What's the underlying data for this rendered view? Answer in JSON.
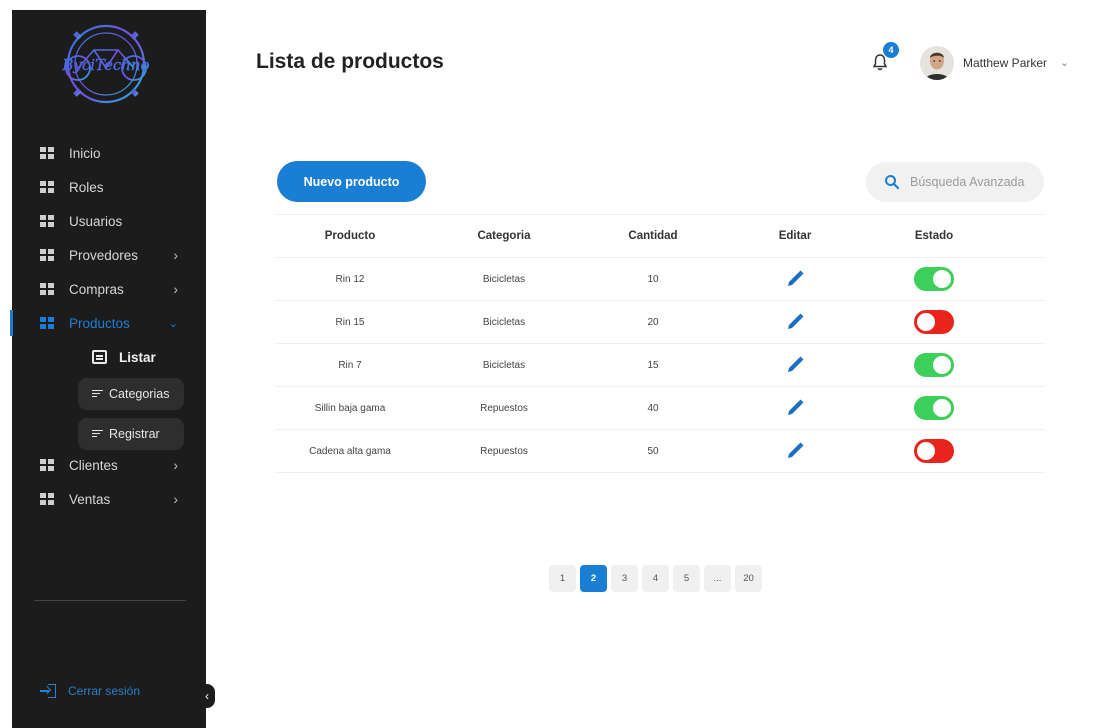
{
  "sidebar": {
    "logo_text": "ByciTechno",
    "items": [
      {
        "label": "Inicio",
        "has_chevron": false,
        "active": false
      },
      {
        "label": "Roles",
        "has_chevron": false,
        "active": false
      },
      {
        "label": "Usuarios",
        "has_chevron": false,
        "active": false
      },
      {
        "label": "Provedores",
        "has_chevron": true,
        "active": false
      },
      {
        "label": "Compras",
        "has_chevron": true,
        "active": false
      },
      {
        "label": "Productos",
        "has_chevron": true,
        "active": true
      }
    ],
    "submenu": {
      "listar": "Listar",
      "categorias": "Categorias",
      "registrar": "Registrar"
    },
    "items_after": [
      {
        "label": "Clientes",
        "has_chevron": true
      },
      {
        "label": "Ventas",
        "has_chevron": true
      }
    ],
    "logout_label": "Cerrar sesión",
    "chevron_right": "›",
    "chevron_down": "⌄"
  },
  "header": {
    "title": "Lista de productos",
    "notification_count": "4",
    "user_name": "Matthew Parker",
    "user_chevron": "⌄"
  },
  "toolbar": {
    "new_button": "Nuevo producto",
    "search_placeholder": "Búsqueda Avanzada"
  },
  "table": {
    "columns": [
      "Producto",
      "Categoria",
      "Cantidad",
      "Editar",
      "Estado"
    ],
    "rows": [
      {
        "producto": "Rin 12",
        "categoria": "Bicicletas",
        "cantidad": "10",
        "estado": true
      },
      {
        "producto": "Rin 15",
        "categoria": "Bicicletas",
        "cantidad": "20",
        "estado": false
      },
      {
        "producto": "Rin 7",
        "categoria": "Bicicletas",
        "cantidad": "15",
        "estado": true
      },
      {
        "producto": "Sillin baja gama",
        "categoria": "Repuestos",
        "cantidad": "40",
        "estado": true
      },
      {
        "producto": "Cadena alta gama",
        "categoria": "Repuestos",
        "cantidad": "50",
        "estado": false
      }
    ]
  },
  "pagination": {
    "pages": [
      "1",
      "2",
      "3",
      "4",
      "5",
      "...",
      "20"
    ],
    "current": "2"
  },
  "colors": {
    "accent": "#1a7fd4",
    "sidebar_bg": "#1c1c1c",
    "toggle_on": "#3ccf5a",
    "toggle_off": "#e8241c"
  },
  "icons": {
    "nav": "grid-icon",
    "edit": "pencil-icon",
    "notifications": "bell-icon",
    "search": "search-icon",
    "logout": "logout-icon"
  }
}
